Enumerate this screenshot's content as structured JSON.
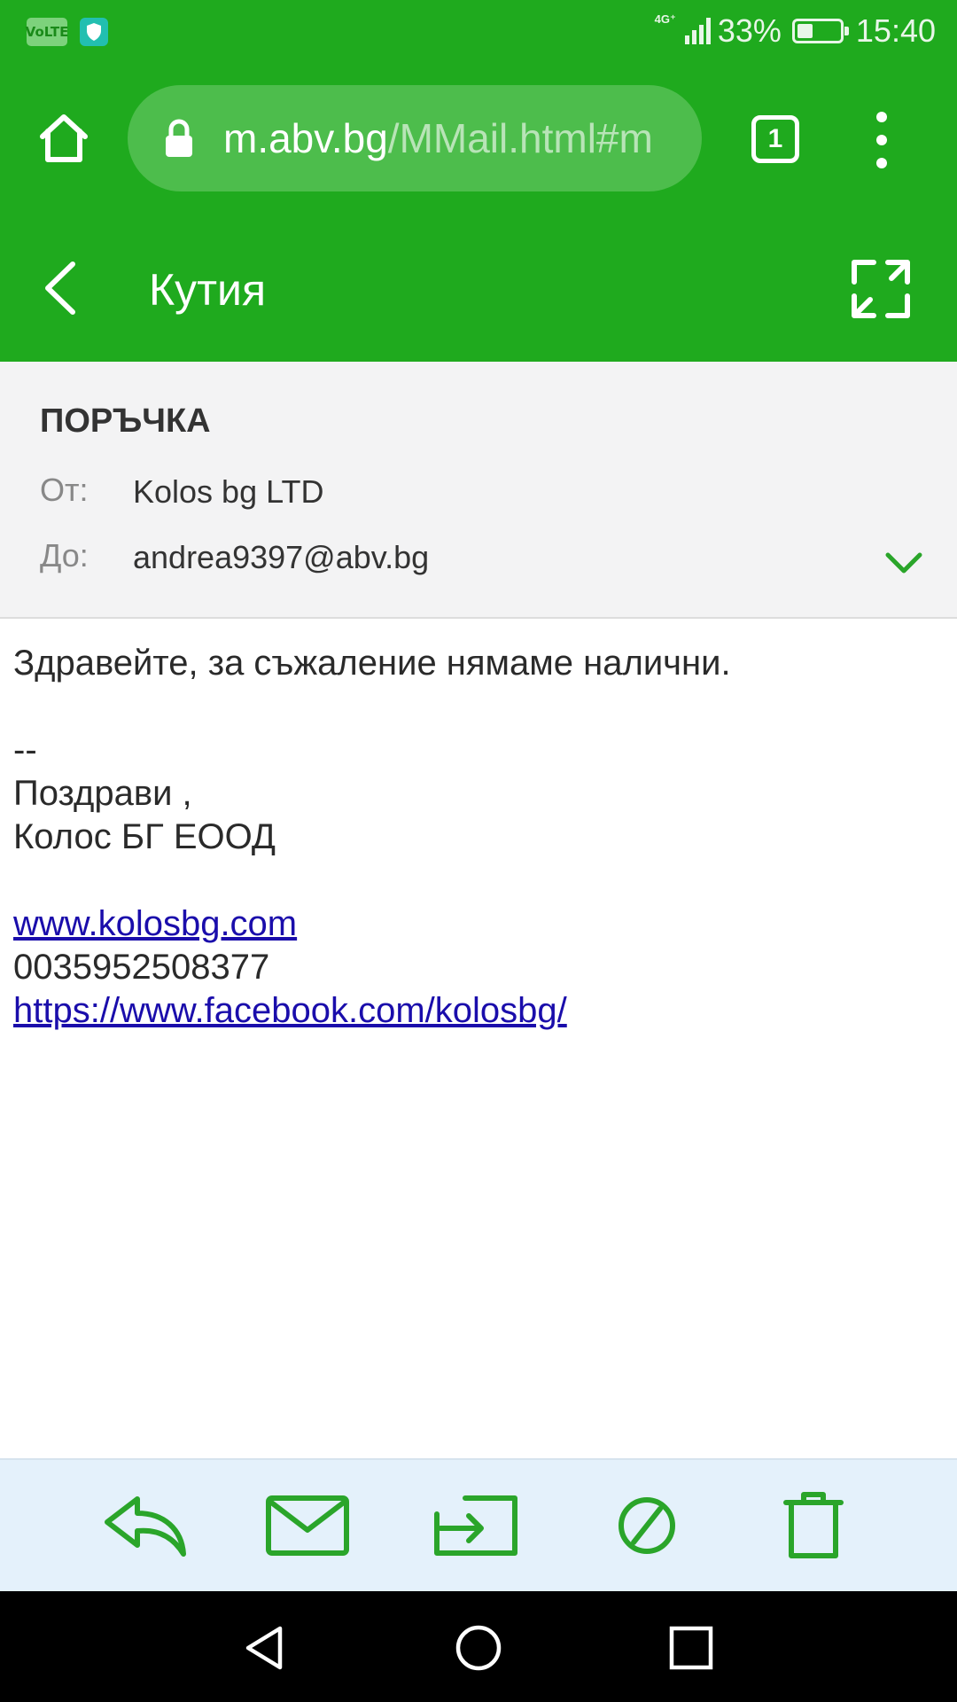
{
  "status_bar": {
    "volte": "VoLTE",
    "network": "4G⁺",
    "battery_percent": "33%",
    "battery_level": 0.33,
    "time": "15:40"
  },
  "browser": {
    "url_host": "m.abv.bg",
    "url_path": "/MMail.html#m",
    "tab_count": "1",
    "icons": [
      "home-icon",
      "lock-icon",
      "tabs-icon",
      "overflow-menu-icon"
    ]
  },
  "app_header": {
    "title": "Кутия",
    "icons": [
      "back-arrow-icon",
      "fullscreen-icon"
    ]
  },
  "message": {
    "subject": "ПОРЪЧКА",
    "from_label": "От:",
    "from_value": "Kolos bg LTD",
    "to_label": "До:",
    "to_value": "andrea9397@abv.bg",
    "body": {
      "line1": "Здравейте, за съжаление нямаме налични.",
      "separator": "--",
      "greeting": "Поздрави ,",
      "company": "Колос БГ ЕООД",
      "website": "www.kolosbg.com",
      "phone": "0035952508377",
      "facebook": "https://www.facebook.com/kolosbg/"
    }
  },
  "actions": [
    "reply-icon",
    "mark-unread-icon",
    "move-icon",
    "spam-icon",
    "delete-icon"
  ],
  "colors": {
    "brand_green": "#1faa1e",
    "action_green": "#2aa52a",
    "link": "#1a0dab",
    "actions_bg": "#e4f1fb"
  }
}
